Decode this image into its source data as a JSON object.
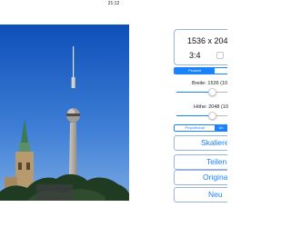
{
  "status_bar": {
    "time": "21:12"
  },
  "image_panel": {
    "size": "1536 x 204",
    "aspect_ratio": "3:4",
    "mode_tabs": [
      "Prozent",
      ""
    ],
    "mode_selected": 0,
    "width_label": "Breite: 1536 (10",
    "height_label": "Höhe: 2048 (10",
    "width_percent": 100,
    "height_percent": 100,
    "scale_tabs": [
      "Proportional",
      "Un"
    ],
    "scale_selected": 1
  },
  "actions": {
    "scale": "Skalieren",
    "share": "Teilen",
    "original": "Original",
    "new": "Neu"
  },
  "colors": {
    "accent": "#1a82fb",
    "sky_top": "#0d4fb8",
    "sky_bottom": "#5f96de"
  }
}
